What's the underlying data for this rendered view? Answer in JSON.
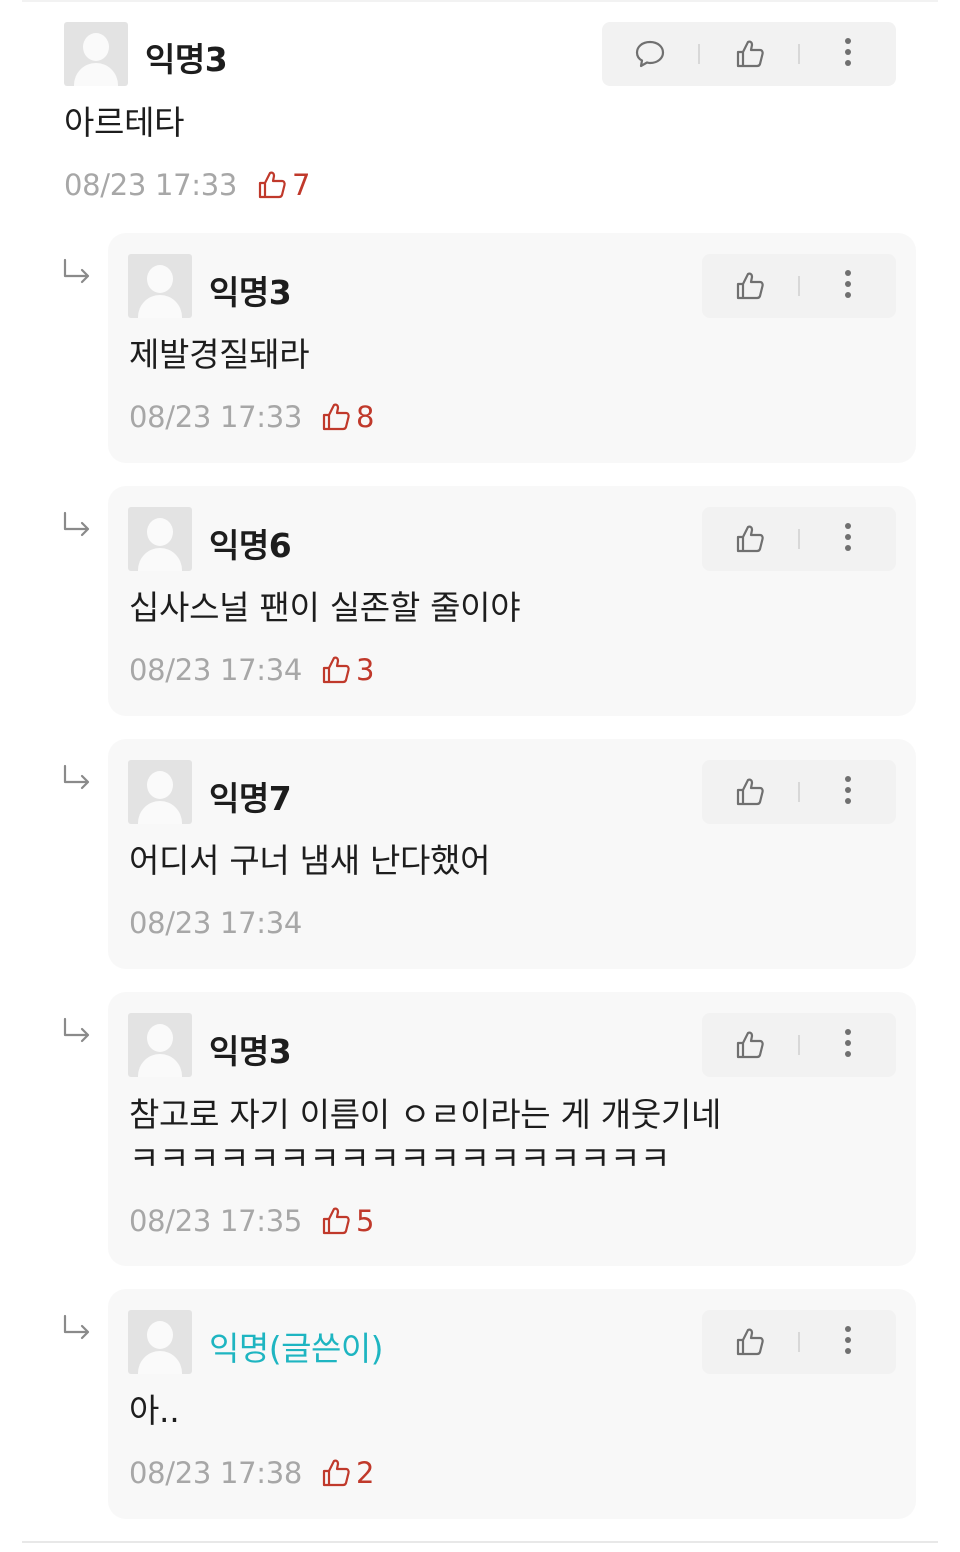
{
  "comments": [
    {
      "name": "익명3",
      "text": "아르테타",
      "time": "08/23 17:33",
      "likes": "7"
    },
    {
      "name": "익명3",
      "text": "제발경질돼라",
      "time": "08/23 17:33",
      "likes": "8"
    },
    {
      "name": "익명6",
      "text": "십사스널 팬이 실존할 줄이야",
      "time": "08/23 17:34",
      "likes": "3"
    },
    {
      "name": "익명7",
      "text": "어디서 구너 냄새 난다했어",
      "time": "08/23 17:34"
    },
    {
      "name": "익명3",
      "text_line1": "참고로 자기 이름이 ㅇㄹ이라는 게 개웃기네",
      "text_line2": "ㅋㅋㅋㅋㅋㅋㅋㅋㅋㅋㅋㅋㅋㅋㅋㅋㅋㅋ",
      "time": "08/23 17:35",
      "likes": "5"
    },
    {
      "name": "익명(글쓴이)",
      "text": "아..",
      "time": "08/23 17:38",
      "likes": "2"
    }
  ],
  "colors": {
    "like": "#c0392b",
    "author": "#1eb5c1",
    "meta": "#a7a7a7",
    "box": "#f8f8f8"
  },
  "icons": {
    "comment": "speech-bubble-icon",
    "like": "thumbs-up-icon",
    "more": "kebab-menu-icon",
    "reply": "reply-arrow-icon"
  }
}
